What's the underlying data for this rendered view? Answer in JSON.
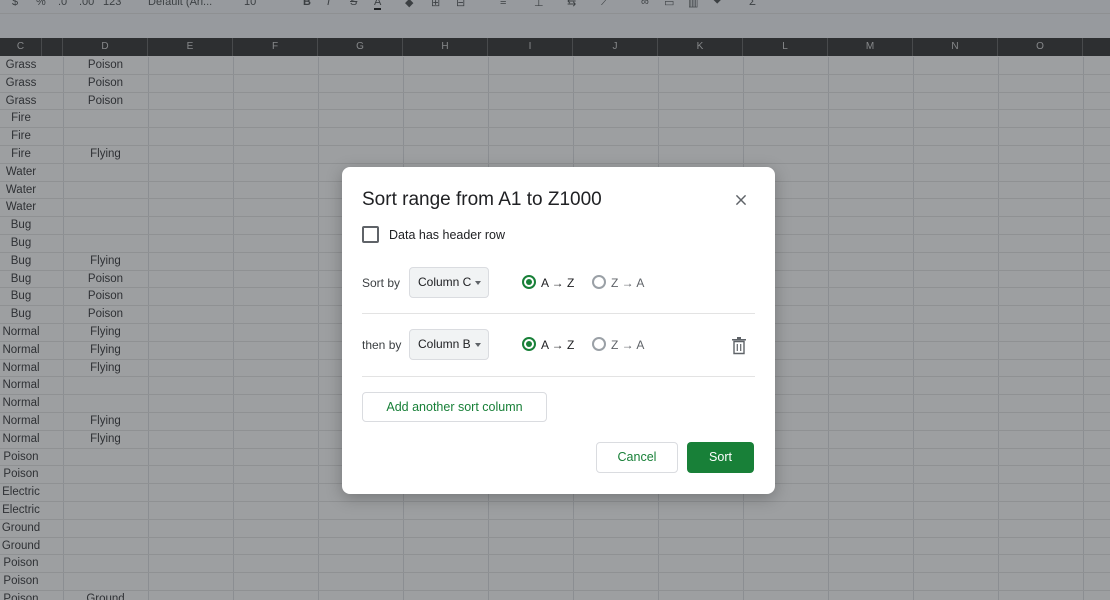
{
  "toolbar": {
    "currency": "$",
    "percent": "%",
    "decrease_decimal": ".0",
    "increase_decimal": ".00",
    "number_format": "123",
    "font_name": "Default (Ari...",
    "font_size": "10",
    "bold": "B",
    "italic": "I",
    "strikethrough": "S",
    "text_color": "A"
  },
  "columns": [
    "C",
    "D",
    "E",
    "F",
    "G",
    "H",
    "I",
    "J",
    "K",
    "L",
    "M",
    "N",
    "O"
  ],
  "rows": [
    {
      "c": "Grass",
      "d": "Poison"
    },
    {
      "c": "Grass",
      "d": "Poison"
    },
    {
      "c": "Grass",
      "d": "Poison"
    },
    {
      "c": "Fire",
      "d": ""
    },
    {
      "c": "Fire",
      "d": ""
    },
    {
      "c": "Fire",
      "d": "Flying"
    },
    {
      "c": "Water",
      "d": ""
    },
    {
      "c": "Water",
      "d": ""
    },
    {
      "c": "Water",
      "d": ""
    },
    {
      "c": "Bug",
      "d": ""
    },
    {
      "c": "Bug",
      "d": ""
    },
    {
      "c": "Bug",
      "d": "Flying"
    },
    {
      "c": "Bug",
      "d": "Poison"
    },
    {
      "c": "Bug",
      "d": "Poison"
    },
    {
      "c": "Bug",
      "d": "Poison"
    },
    {
      "c": "Normal",
      "d": "Flying"
    },
    {
      "c": "Normal",
      "d": "Flying"
    },
    {
      "c": "Normal",
      "d": "Flying"
    },
    {
      "c": "Normal",
      "d": ""
    },
    {
      "c": "Normal",
      "d": ""
    },
    {
      "c": "Normal",
      "d": "Flying"
    },
    {
      "c": "Normal",
      "d": "Flying"
    },
    {
      "c": "Poison",
      "d": ""
    },
    {
      "c": "Poison",
      "d": ""
    },
    {
      "c": "Electric",
      "d": ""
    },
    {
      "c": "Electric",
      "d": ""
    },
    {
      "c": "Ground",
      "d": ""
    },
    {
      "c": "Ground",
      "d": ""
    },
    {
      "c": "Poison",
      "d": ""
    },
    {
      "c": "Poison",
      "d": ""
    },
    {
      "c": "Poison",
      "d": "Ground"
    }
  ],
  "dialog": {
    "title": "Sort range from A1 to Z1000",
    "header_checkbox_label": "Data has header row",
    "sort_by_label": "Sort by",
    "sort_by_column": "Column C",
    "then_by_label": "then by",
    "then_by_column": "Column B",
    "asc_label": "A → Z",
    "desc_label": "Z → A",
    "add_sort_column": "Add another sort column",
    "cancel": "Cancel",
    "sort": "Sort"
  },
  "colors": {
    "accent_green": "#188038",
    "overlay": "rgba(60,64,67,0.5)",
    "header_dark": "#1f1f1f"
  }
}
